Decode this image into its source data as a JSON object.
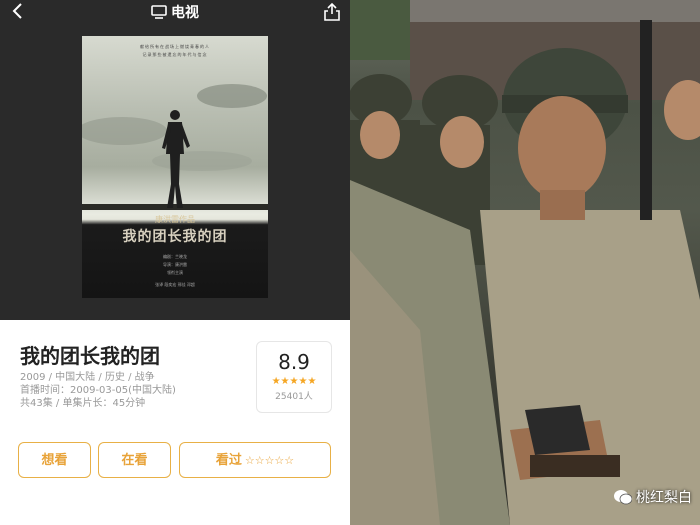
{
  "nav": {
    "title": "电视"
  },
  "poster": {
    "credit_line1": "献给所有在战场上燃烧青春的人",
    "credit_line2": "记录那些被遗忘的年代与信念",
    "maker": "康洪雷作品",
    "title": "我的团长我的团",
    "staff_line1": "编剧：兰晓龙",
    "staff_line2": "导演：康洪雷",
    "staff_line3": "领衔主演",
    "staff_line4": "张译 段奕宏 邢佳 邓超"
  },
  "show": {
    "title": "我的团长我的团",
    "meta_line1": "2009 / 中国大陆 / 历史 / 战争",
    "meta_line2": "首播时间：2009-03-05(中国大陆)",
    "meta_line3": "共43集 / 单集片长：45分钟"
  },
  "rating": {
    "score": "8.9",
    "stars": "★★★★★",
    "votes": "25401人"
  },
  "buttons": {
    "want": "想看",
    "watching": "在看",
    "watched": "看过",
    "watched_stars": "☆☆☆☆☆"
  },
  "watermark": {
    "text": "桃红梨白"
  },
  "colors": {
    "accent": "#e8a339",
    "star": "#f5a623"
  }
}
